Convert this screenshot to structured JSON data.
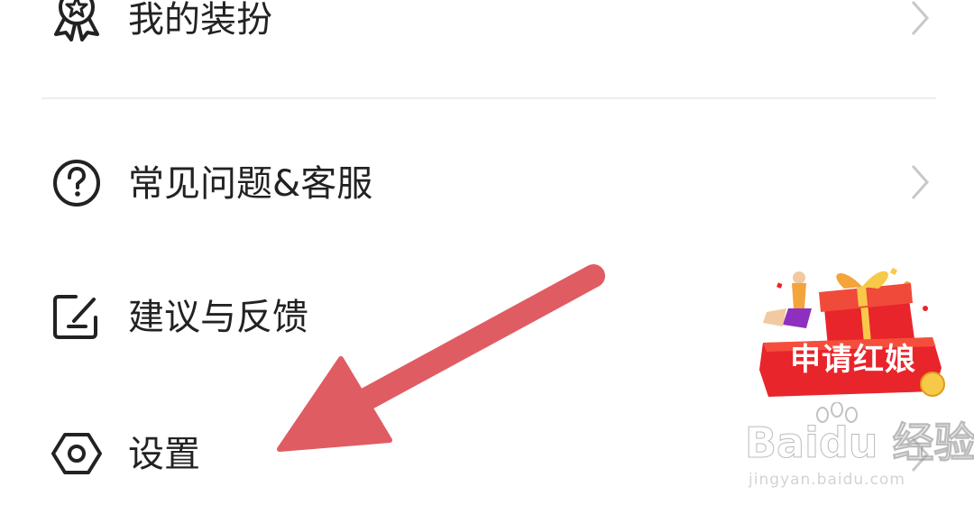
{
  "menu": {
    "items": [
      {
        "label": "我的装扮",
        "icon": "medal-icon"
      },
      {
        "label": "常见问题&客服",
        "icon": "question-circle-icon"
      },
      {
        "label": "建议与反馈",
        "icon": "feedback-edit-icon"
      },
      {
        "label": "设置",
        "icon": "hexagon-settings-icon"
      }
    ]
  },
  "promo": {
    "label": "申请红娘",
    "color": "#e8252b"
  },
  "annotation": {
    "arrow_color": "#e05c63"
  },
  "watermark": {
    "logo": "Baidu 经验",
    "url": "jingyan.baidu.com"
  },
  "colors": {
    "text": "#222222",
    "icon": "#222222",
    "chevron": "#c8c8c8",
    "divider": "#eeeeee",
    "background": "#ffffff"
  }
}
